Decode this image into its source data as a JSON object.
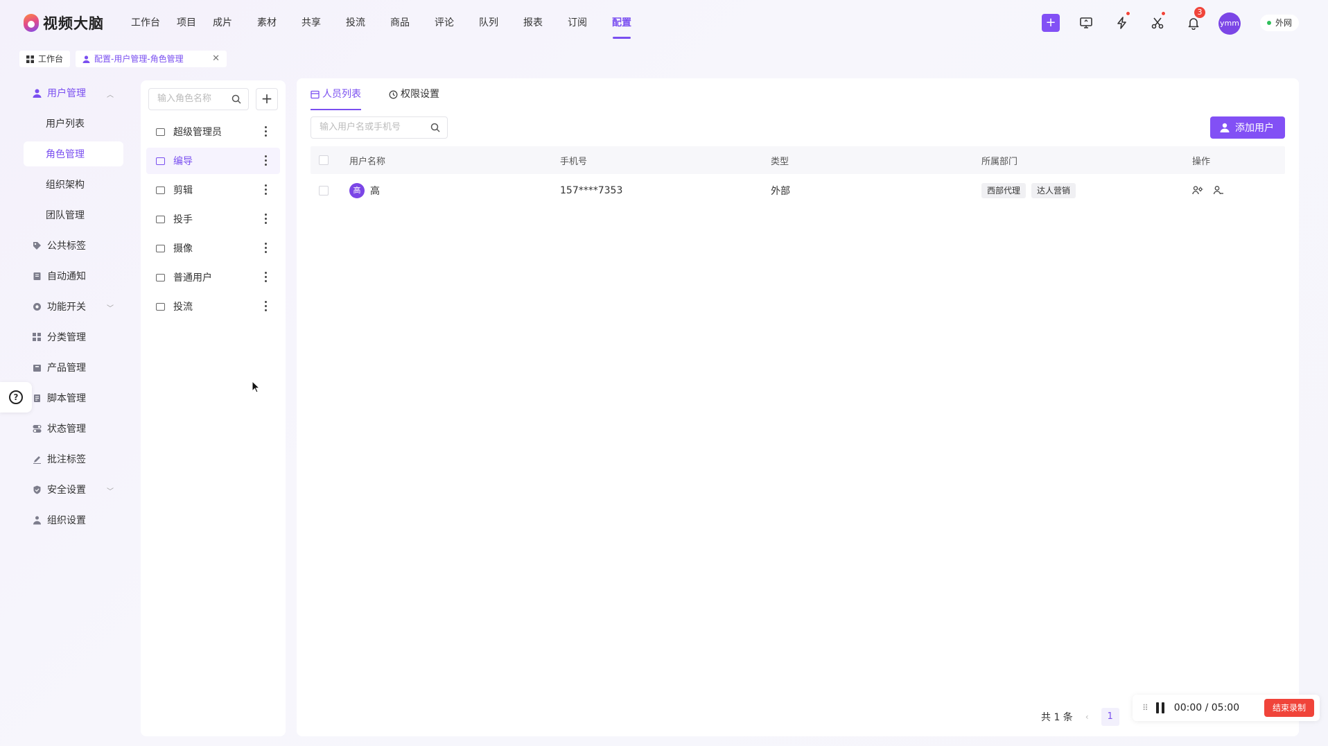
{
  "app": {
    "logo_text": "视频大脑"
  },
  "nav": [
    "工作台",
    "项目",
    "成片",
    "素材",
    "共享",
    "投流",
    "商品",
    "评论",
    "队列",
    "报表",
    "订阅",
    "配置"
  ],
  "top": {
    "notification_count": "3",
    "avatar_text": "ymm",
    "network_label": "外网"
  },
  "page_tabs": [
    {
      "label": "工作台"
    },
    {
      "label": "配置-用户管理-角色管理"
    }
  ],
  "sidebar": {
    "user_mgmt": "用户管理",
    "user_list": "用户列表",
    "role_mgmt": "角色管理",
    "org_structure": "组织架构",
    "team_mgmt": "团队管理",
    "public_tags": "公共标签",
    "auto_notify": "自动通知",
    "feature_switch": "功能开关",
    "category_mgmt": "分类管理",
    "product_mgmt": "产品管理",
    "script_mgmt": "脚本管理",
    "status_mgmt": "状态管理",
    "annotation_tags": "批注标签",
    "security_settings": "安全设置",
    "org_settings": "组织设置"
  },
  "roles": {
    "search_placeholder": "输入角色名称",
    "items": [
      "超级管理员",
      "编导",
      "剪辑",
      "投手",
      "摄像",
      "普通用户",
      "投流"
    ]
  },
  "main": {
    "tabs": [
      "人员列表",
      "权限设置"
    ],
    "search_placeholder": "输入用户名或手机号",
    "add_user_label": "添加用户",
    "columns": [
      "用户名称",
      "手机号",
      "类型",
      "所属部门",
      "操作"
    ],
    "rows": [
      {
        "avatar": "高",
        "name": "高",
        "phone": "157****7353",
        "type": "外部",
        "depts": [
          "西部代理",
          "达人营销"
        ]
      }
    ],
    "pager": {
      "total_text": "共 1 条",
      "current_page": "1"
    }
  },
  "recorder": {
    "time": "00:00 / 05:00",
    "stop_label": "结束录制"
  },
  "colors": {
    "accent": "#7a4ff0",
    "button": "#8250f5",
    "danger": "#f0443a"
  }
}
